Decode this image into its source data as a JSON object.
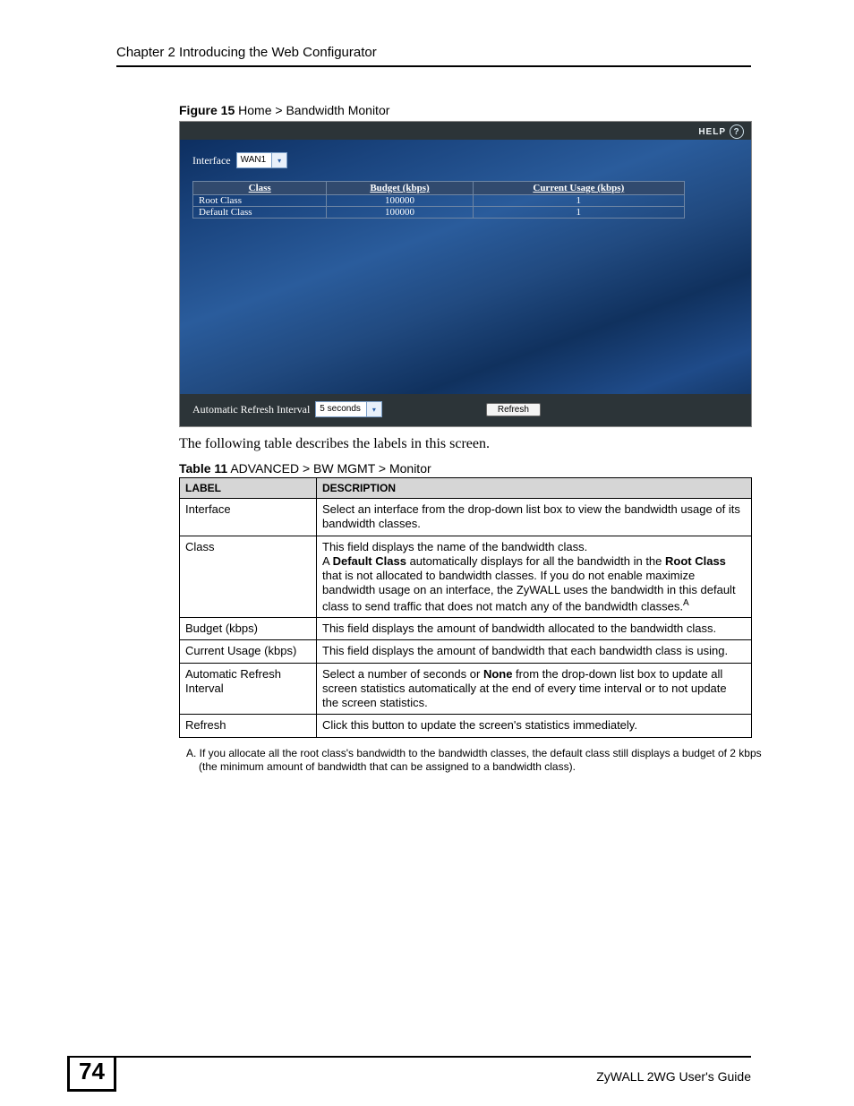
{
  "chapter_header": "Chapter 2 Introducing the Web Configurator",
  "figure": {
    "label_bold": "Figure 15",
    "label_rest": "   Home > Bandwidth Monitor"
  },
  "screenshot": {
    "help_label": "HELP",
    "interface_label": "Interface",
    "interface_value": "WAN1",
    "table_headers": {
      "class": "Class",
      "budget": "Budget (kbps)",
      "usage": "Current Usage (kbps)"
    },
    "rows": [
      {
        "class": "Root Class",
        "budget": "100000",
        "usage": "1"
      },
      {
        "class": "Default Class",
        "budget": "100000",
        "usage": "1"
      }
    ],
    "refresh_interval_label": "Automatic Refresh Interval",
    "refresh_interval_value": "5 seconds",
    "refresh_button": "Refresh"
  },
  "body_text": "The following table describes the labels in this screen.",
  "table_caption": {
    "bold": "Table 11",
    "rest": "   ADVANCED > BW MGMT > Monitor"
  },
  "desc_table": {
    "headers": {
      "label": "LABEL",
      "description": "DESCRIPTION"
    },
    "rows": {
      "r0": {
        "label": "Interface",
        "desc": "Select an interface from the drop-down list box to view the bandwidth usage of its bandwidth classes."
      },
      "r1": {
        "label": "Class",
        "line1": "This field displays the name of the bandwidth class.",
        "line2_pre": "A ",
        "line2_b1": "Default Class",
        "line2_mid": " automatically displays for all the bandwidth in the ",
        "line2_b2": "Root Class",
        "line2_post": " that is not allocated to bandwidth classes. If you do not enable maximize bandwidth usage on an interface, the ZyWALL uses the bandwidth in this default class to send traffic that does not match any of the bandwidth classes.",
        "sup": "A"
      },
      "r2": {
        "label": "Budget (kbps)",
        "desc": "This field displays the amount of bandwidth allocated to the bandwidth class."
      },
      "r3": {
        "label": "Current Usage (kbps)",
        "desc": "This field displays the amount of bandwidth that each bandwidth class is using."
      },
      "r4": {
        "label": "Automatic Refresh Interval",
        "pre": "Select a number of seconds or ",
        "b": "None",
        "post": " from the drop-down list box to update all screen statistics automatically at the end of every time interval or to not update the screen statistics."
      },
      "r5": {
        "label": "Refresh",
        "desc": "Click this button to update the screen's statistics immediately."
      }
    }
  },
  "footnote": "A. If you allocate all the root class's bandwidth to the bandwidth classes, the default class still displays a budget of 2 kbps (the minimum amount of bandwidth that can be assigned to a bandwidth class).",
  "footer": {
    "page_number": "74",
    "guide": "ZyWALL 2WG User's Guide"
  }
}
